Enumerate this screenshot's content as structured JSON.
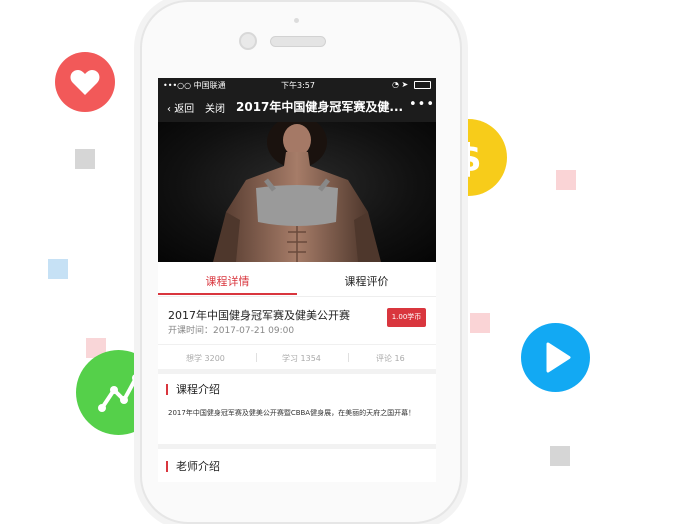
{
  "colors": {
    "heart_bg": "#f25959",
    "dollar_bg": "#f7cc1a",
    "chart_bg": "#55d04a",
    "play_bg": "#12a9f3",
    "accent_red": "#d9363e"
  },
  "status_bar": {
    "carrier": "•••○○ 中国联通",
    "time": "下午3:57"
  },
  "nav": {
    "back": "返回",
    "close": "关闭",
    "title": "2017年中国健身冠军赛及健...",
    "more": "•••"
  },
  "tabs": [
    "课程详情",
    "课程评价"
  ],
  "course": {
    "title": "2017年中国健身冠军赛及健美公开赛",
    "time": "开课时间：2017-07-21 09:00",
    "price": "1.00学币"
  },
  "stats": [
    "想学 3200",
    "学习 1354",
    "评论 16"
  ],
  "sections": {
    "intro_title": "课程介绍",
    "intro_text": "2017年中国健身冠军赛及健美公开赛暨CBBA健身展，在美丽的天府之国开幕！",
    "teacher_title": "老师介绍"
  }
}
